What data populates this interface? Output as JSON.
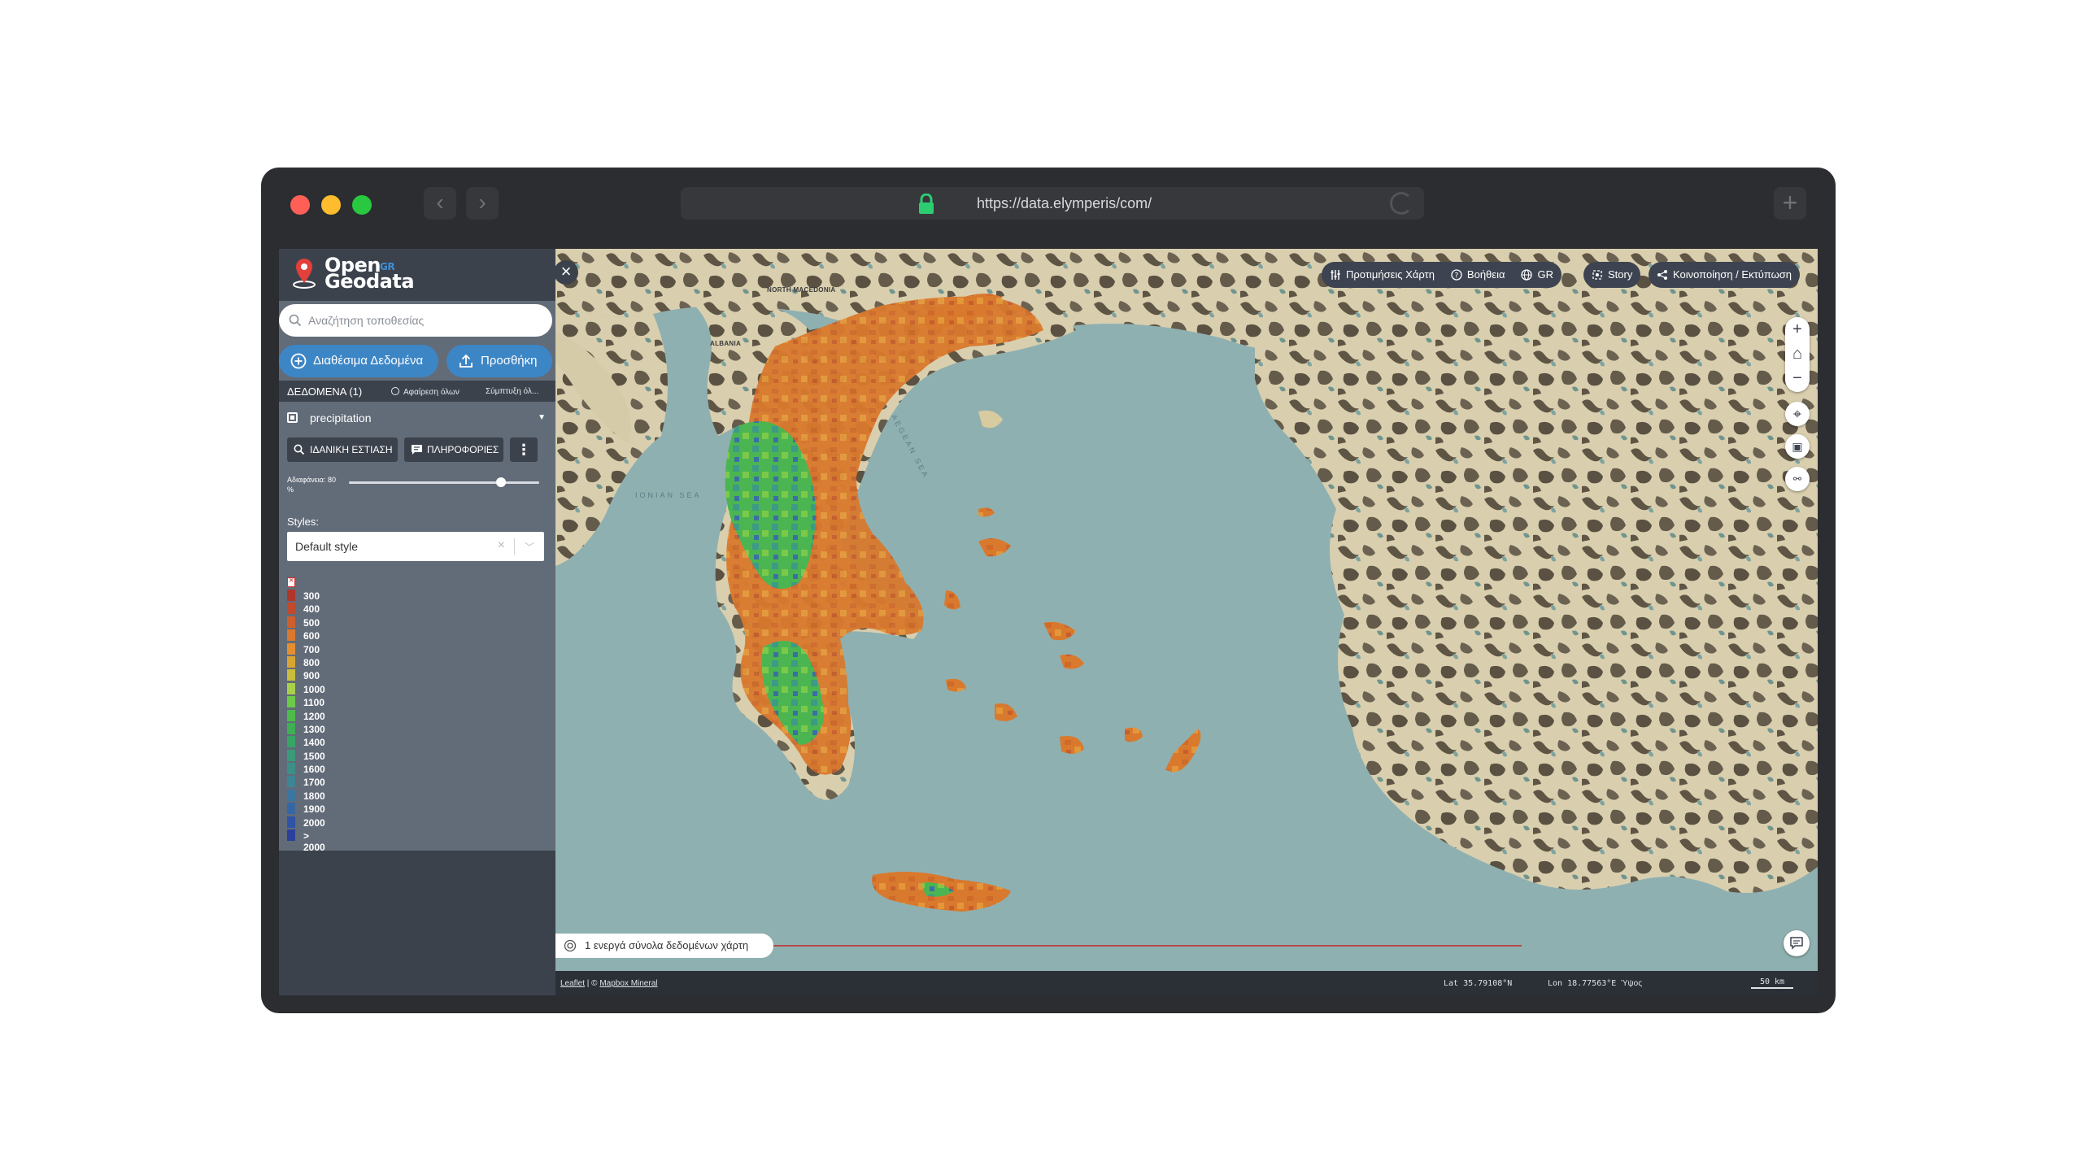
{
  "browser": {
    "url": "https://data.elymperis/com/"
  },
  "app": {
    "logo_text_top": "Open",
    "logo_text_bottom": "Geodata",
    "logo_badge": "GR"
  },
  "sidebar": {
    "search_placeholder": "Αναζήτηση τοποθεσίας",
    "available_data_label": "Διαθέσιμα Δεδομένα",
    "add_label": "Προσθήκη",
    "data_count_label": "ΔΕΔΟΜΕΝΑ (1)",
    "remove_all_label": "Αφαίρεση όλων",
    "collapse_all_label": "Σύμπτυξη όλ...",
    "layer": {
      "name": "precipitation",
      "ideal_zoom_label": "ΙΔΑΝΙΚΗ ΕΣΤΙΑΣΗ",
      "info_label": "ΠΛΗΡΟΦΟΡΙΕΣ",
      "opacity_label": "Αδιαφάνεια: 80 %",
      "opacity_value": 80,
      "styles_label": "Styles:",
      "style_value": "Default style"
    },
    "legend": [
      {
        "label": "300",
        "color": "#b2352b"
      },
      {
        "label": "400",
        "color": "#c14a2c"
      },
      {
        "label": "500",
        "color": "#cf5f2d"
      },
      {
        "label": "600",
        "color": "#db782f"
      },
      {
        "label": "700",
        "color": "#e38e31"
      },
      {
        "label": "800",
        "color": "#d9a532"
      },
      {
        "label": "900",
        "color": "#c9bd3d"
      },
      {
        "label": "1000",
        "color": "#a9d04a"
      },
      {
        "label": "1100",
        "color": "#6cc94a"
      },
      {
        "label": "1200",
        "color": "#4dbb4c"
      },
      {
        "label": "1300",
        "color": "#3fae55"
      },
      {
        "label": "1400",
        "color": "#37a466"
      },
      {
        "label": "1500",
        "color": "#3a9b7a"
      },
      {
        "label": "1600",
        "color": "#3d9088"
      },
      {
        "label": "1700",
        "color": "#3e8594"
      },
      {
        "label": "1800",
        "color": "#3b76a0"
      },
      {
        "label": "1900",
        "color": "#3566a6"
      },
      {
        "label": "2000",
        "color": "#2f54a6"
      },
      {
        "label": ">  2000",
        "color": "#2b3f9c"
      }
    ]
  },
  "map": {
    "toolbar": {
      "preferences_label": "Προτιμήσεις Χάρτη",
      "help_label": "Βοήθεια",
      "language_label": "GR",
      "story_label": "Story",
      "share_label": "Κοινοποίηση / Εκτύπωση"
    },
    "active_datasets_label": "1 ενεργά σύνολα δεδομένων χάρτη",
    "labels": {
      "north_macedonia": "NORTH MACEDONIA",
      "albania": "ALBANIA",
      "ionian_sea": "IONIAN SEA",
      "aegean_sea": "AEGEAN SEA"
    }
  },
  "statusbar": {
    "leaflet": "Leaflet",
    "separator": " | © ",
    "mapbox": "Mapbox Mineral",
    "lat": "Lat  35.79108°N",
    "lon": "Lon  18.77563°E",
    "alt": "Ύψος",
    "scale": "50 km"
  }
}
